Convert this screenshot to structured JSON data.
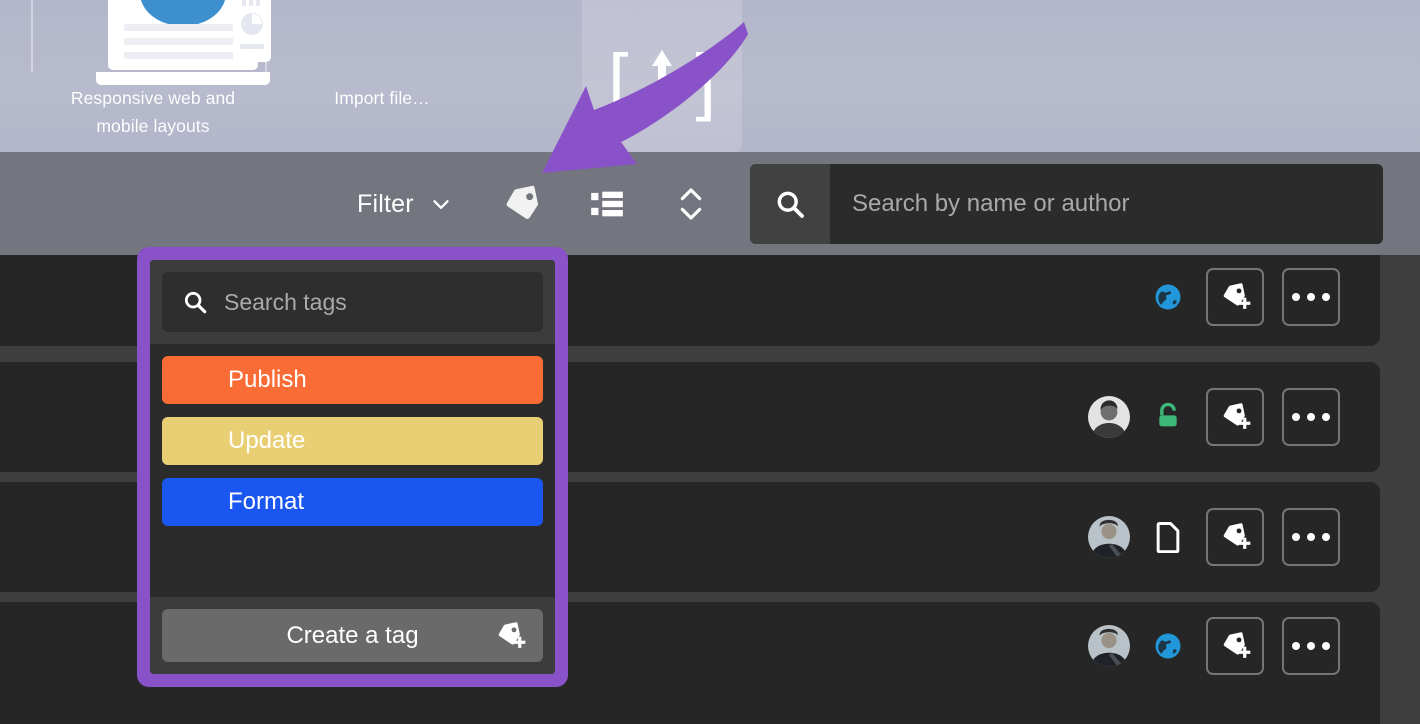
{
  "gallery": {
    "dividers": 2,
    "templates": [
      {
        "id": "responsive-web",
        "label": "Responsive web and\nmobile layouts",
        "icon": "laptop-phone-thumbnail"
      },
      {
        "id": "import-file",
        "label": "Import file…",
        "icon": "import-brackets-thumbnail"
      }
    ]
  },
  "toolbar": {
    "filter_label": "Filter",
    "filter_chevron_icon": "chevron-down-icon",
    "tag_icon": "tag-icon",
    "list_view_icon": "list-view-icon",
    "sort_icon": "sort-updown-icon",
    "search": {
      "icon": "search-icon",
      "value": "",
      "placeholder": "Search by name or author"
    }
  },
  "annotation": {
    "arrow_color": "#8a52c9",
    "arrow_target": "tag-icon",
    "highlight_color": "#8a52c9"
  },
  "tag_dropdown": {
    "search": {
      "icon": "search-icon",
      "value": "",
      "placeholder": "Search tags"
    },
    "tags": [
      {
        "label": "Publish",
        "color": "#f96c35",
        "text_color": "#ffffff"
      },
      {
        "label": "Update",
        "color": "#e9cf73",
        "text_color": "#ffffff"
      },
      {
        "label": "Format",
        "color": "#1a56f0",
        "text_color": "#ffffff"
      }
    ],
    "create_label": "Create a tag",
    "create_icon": "tag-plus-icon"
  },
  "list": {
    "rows": [
      {
        "avatar": null,
        "status_icon": "globe-icon",
        "status_color": "#2196d8",
        "tag_icon": "tag-plus-icon",
        "more_icon": "more-horizontal-icon"
      },
      {
        "avatar": "avatar-woman",
        "status_icon": "lock-icon",
        "status_color": "#3cb878",
        "tag_icon": "tag-plus-icon",
        "more_icon": "more-horizontal-icon"
      },
      {
        "avatar": "avatar-man",
        "status_icon": "file-icon",
        "status_color": "#ffffff",
        "tag_icon": "tag-plus-icon",
        "more_icon": "more-horizontal-icon"
      },
      {
        "avatar": "avatar-man",
        "status_icon": "globe-icon",
        "status_color": "#2196d8",
        "tag_icon": "tag-plus-icon",
        "more_icon": "more-horizontal-icon"
      }
    ]
  },
  "colors": {
    "gallery_bg": "#b6b8cb",
    "toolbar_bg": "#73757f",
    "list_bg": "#3e3e3f",
    "row_bg": "#262626",
    "accent_purple": "#8a52c9"
  }
}
